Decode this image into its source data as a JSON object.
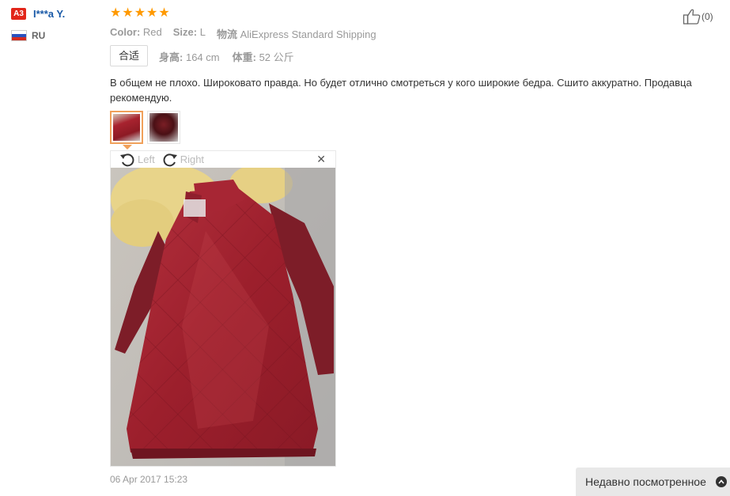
{
  "reviewer": {
    "level_badge": "A3",
    "name": "I***a Y.",
    "country_code": "RU"
  },
  "rating": {
    "stars": 5,
    "max": 5
  },
  "attributes": [
    {
      "key": "Color:",
      "value": "Red"
    },
    {
      "key": "Size:",
      "value": "L"
    },
    {
      "key": "物流",
      "value": "AliExpress Standard Shipping"
    }
  ],
  "fit": "合适",
  "body_info": [
    {
      "key": "身高:",
      "value": "164 cm"
    },
    {
      "key": "体重:",
      "value": "52 公斤"
    }
  ],
  "review_text": "В общем не плохо. Широковато правда. Но будет отлично смотреться у кого широкие бедра. Сшито аккуратно. Продавца рекомендую.",
  "viewer": {
    "rotate_left_label": "Left",
    "rotate_right_label": "Right",
    "close_icon": "close-icon"
  },
  "date": "06 Apr 2017 15:23",
  "helpful": {
    "count_label": "(0)",
    "icon": "thumbs-up-icon"
  },
  "recently_viewed": {
    "label": "Недавно посмотренное",
    "icon": "chevron-up-icon"
  },
  "colors": {
    "accent_star": "#ff9900",
    "badge": "#e2261a",
    "name_link": "#1a5aa8"
  }
}
